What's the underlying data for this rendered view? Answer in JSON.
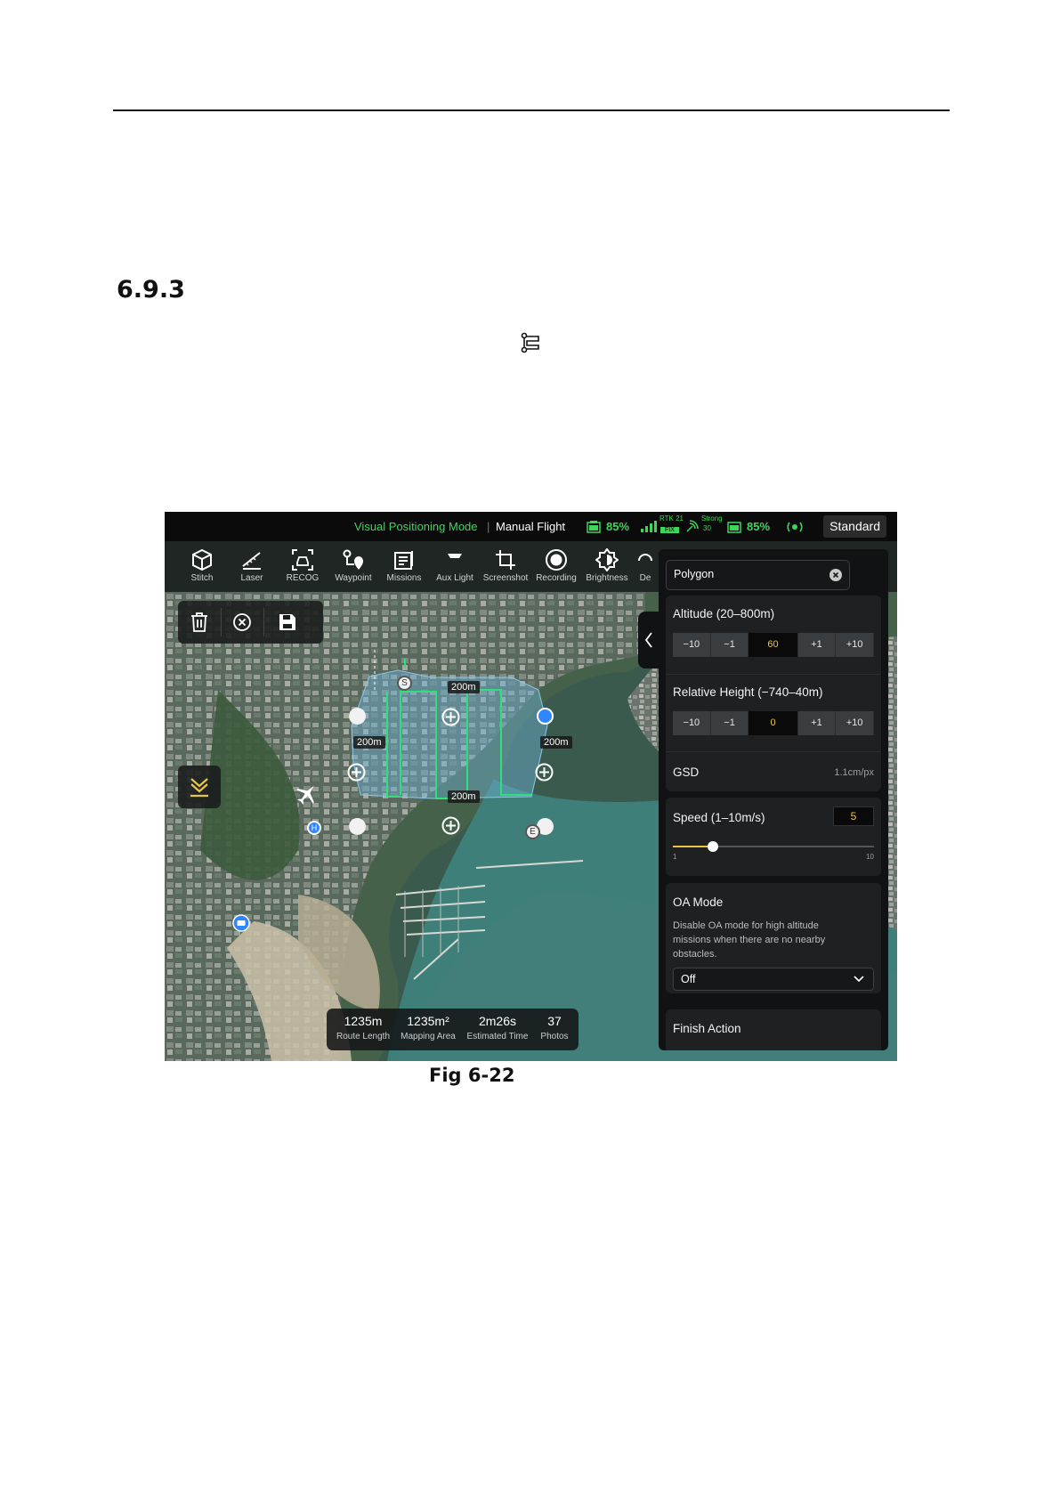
{
  "section": {
    "number": "6.9.3"
  },
  "figure": {
    "caption": "Fig 6-22",
    "status_bar": {
      "mode": "Visual Positioning Mode",
      "flight_mode": "Manual Flight",
      "aircraft_battery": "85%",
      "rtk_label": "RTK 21",
      "rtk_fix": "FIX",
      "signal_label": "Strong",
      "signal_value": "30",
      "rc_battery": "85%",
      "profile_button": "Standard"
    },
    "toolbar": {
      "items": [
        {
          "label": "Stitch",
          "icon": "stitch-icon"
        },
        {
          "label": "Laser",
          "icon": "laser-ruler-icon"
        },
        {
          "label": "RECOG",
          "icon": "car-recognition-icon"
        },
        {
          "label": "Waypoint",
          "icon": "waypoint-icon"
        },
        {
          "label": "Missions",
          "icon": "missions-icon"
        },
        {
          "label": "Aux Light",
          "icon": "aux-light-icon"
        },
        {
          "label": "Screenshot",
          "icon": "screenshot-icon"
        },
        {
          "label": "Recording",
          "icon": "record-icon"
        },
        {
          "label": "Brightness",
          "icon": "brightness-icon"
        },
        {
          "label": "De",
          "icon": "defog-icon"
        }
      ]
    },
    "map": {
      "dimension_labels": [
        "200m",
        "200m",
        "200m",
        "200m"
      ],
      "start_marker": "S",
      "end_marker": "E",
      "home_marker": "H"
    },
    "stats": [
      {
        "value": "1235m",
        "label": "Route Length"
      },
      {
        "value": "1235m²",
        "label": "Mapping Area"
      },
      {
        "value": "2m26s",
        "label": "Estimated Time"
      },
      {
        "value": "37",
        "label": "Photos"
      }
    ],
    "panel": {
      "mission_name": "Polygon",
      "altitude": {
        "label": "Altitude (20–800m)",
        "steps": [
          "−10",
          "−1",
          "60",
          "+1",
          "+10"
        ]
      },
      "relative_height": {
        "label": "Relative Height (−740–40m)",
        "steps": [
          "−10",
          "−1",
          "0",
          "+1",
          "+10"
        ]
      },
      "gsd": {
        "label": "GSD",
        "value": "1.1cm/px"
      },
      "speed": {
        "label": "Speed (1–10m/s)",
        "value": "5",
        "min_label": "1",
        "max_label": "10",
        "level": 0.2
      },
      "oa_mode": {
        "label": "OA Mode",
        "description": "Disable OA mode for high altitude missions when there are no nearby obstacles.",
        "value": "Off"
      },
      "finish_action": {
        "label": "Finish Action"
      }
    },
    "colors": {
      "accent_green": "#3ed65a",
      "route_green": "#2fe07a",
      "value_yellow": "#e8c547",
      "selected_blue": "#2f86ff"
    }
  }
}
